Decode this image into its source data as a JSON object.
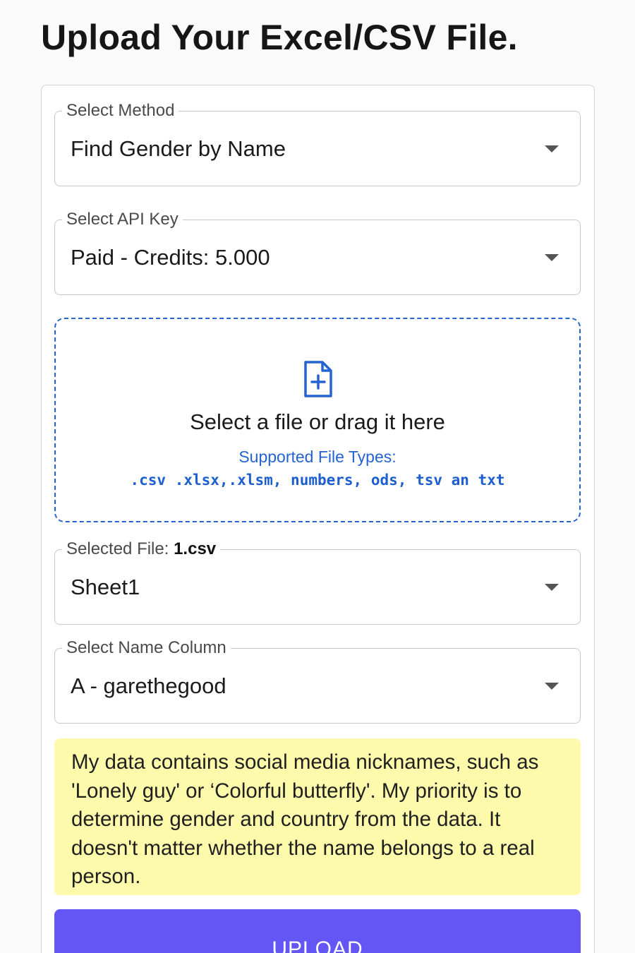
{
  "page": {
    "title": "Upload Your Excel/CSV File."
  },
  "method_select": {
    "label": "Select Method",
    "value": "Find Gender by Name"
  },
  "api_key_select": {
    "label": "Select API Key",
    "value": "Paid - Credits: 5.000"
  },
  "dropzone": {
    "icon": "file-plus-icon",
    "text": "Select a file or drag it here",
    "types_label": "Supported File Types:",
    "types": ".csv .xlsx,.xlsm, numbers, ods, tsv an txt"
  },
  "sheet_select": {
    "label_prefix": "Selected File:",
    "file_name": "1.csv",
    "value": "Sheet1"
  },
  "name_column_select": {
    "label": "Select Name Column",
    "value": "A - garethegood"
  },
  "note": {
    "text": "My data contains social media nicknames, such as 'Lonely guy' or ‘Colorful butterfly'. My priority is to determine gender and country from the data. It doesn't matter whether the name belongs to a real person."
  },
  "upload_button": {
    "label": "UPLOAD"
  },
  "colors": {
    "accent": "#2563d4",
    "button": "#6456f5",
    "note_background": "#fdfbab"
  }
}
